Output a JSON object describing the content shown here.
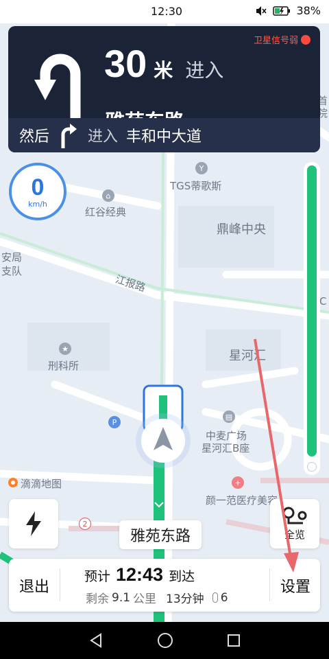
{
  "status": {
    "time": "12:30",
    "battery": "38%"
  },
  "guidance": {
    "gps_warning": "卫星信号弱",
    "distance_value": "30",
    "distance_unit": "米",
    "action": "进入",
    "road": "雅苑东路",
    "next_then": "然后",
    "next_action": "进入",
    "next_road": "丰和中大道"
  },
  "speed": {
    "value": "0",
    "unit": "km/h"
  },
  "progress": {
    "fraction": 0.95
  },
  "map_labels": {
    "tgs": "TGS蒂歌斯",
    "honggu": "红谷经典",
    "dingfeng": "鼎峰中央",
    "anju": "安局",
    "zhidui": "支队",
    "jiangbao": "江报路",
    "xinghehui": "星河汇",
    "xingke": "刑科所",
    "zhongmai": "中麦广场",
    "xinghehui_b": "星河汇B座",
    "didi": "滴滴地图",
    "yiyifan": "颜一范医疗美容",
    "right_edge_1": "首",
    "right_edge_2": "院",
    "right_edge_3": "C",
    "poi_num": "2"
  },
  "buttons": {
    "overview": "全览",
    "exit": "退出",
    "settings": "设置"
  },
  "current_road": "雅苑东路",
  "eta": {
    "prefix": "预计",
    "time": "12:43",
    "suffix": "到达",
    "remaining_label": "剩余",
    "distance": "9.1",
    "distance_unit": "公里",
    "duration": "13分钟",
    "lights": "6"
  },
  "colors": {
    "panel": "#1b2436",
    "route": "#1fc27a",
    "accent": "#2d76dc",
    "warning": "#ff4a40",
    "annotation": "#e8676b"
  }
}
